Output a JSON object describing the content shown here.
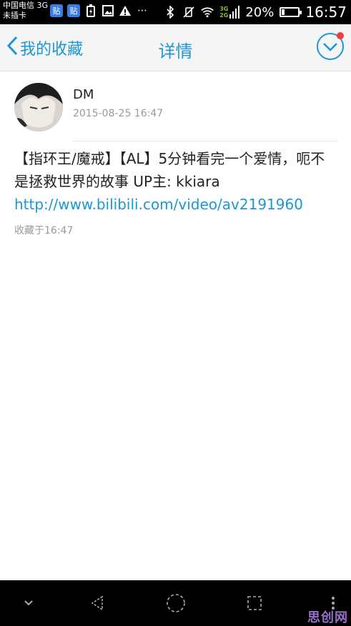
{
  "status_bar": {
    "carrier_line1": "中国电信 3G",
    "carrier_line2": "未插卡",
    "tie_badge_1": "贴",
    "tie_badge_2": "贴",
    "network_3g": "3G",
    "network_2g": "2G",
    "battery_percent": "20%",
    "battery_level": 0.2,
    "time": "16:57"
  },
  "header": {
    "back_label": "我的收藏",
    "title": "详情"
  },
  "post": {
    "author": "DM",
    "date": "2015-08-25 16:47",
    "text": "【指环王/魔戒】【AL】5分钟看完一个爱情，呃不是拯救世界的故事 UP主: kkiara ",
    "link": "http://www.bilibili.com/video/av2191960",
    "favorited_at": "收藏于16:47"
  },
  "colors": {
    "accent": "#1b97d5",
    "badge": "#f23c3c"
  },
  "watermark": "思创网"
}
